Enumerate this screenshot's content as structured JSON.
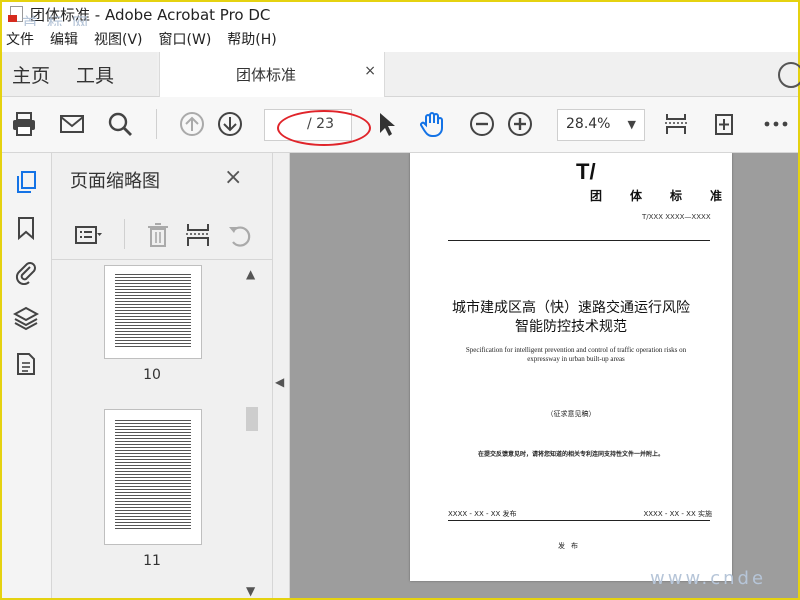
{
  "window": {
    "title": "团体标准 - Adobe Acrobat Pro DC",
    "watermark_top": "首 标 网",
    "watermark_bottom": "www.cnde"
  },
  "menu": [
    "文件",
    "编辑",
    "视图(V)",
    "窗口(W)",
    "帮助(H)"
  ],
  "tabs": {
    "home": "主页",
    "tools": "工具",
    "document": "团体标准",
    "close_glyph": "×"
  },
  "toolbar": {
    "page_current": "",
    "page_total": "/ 23",
    "zoom": "28.4%",
    "zoom_arrow": "▼"
  },
  "thumbnail_panel": {
    "title": "页面缩略图",
    "close_glyph": "×",
    "pages": [
      {
        "label": "10"
      },
      {
        "label": "11"
      }
    ]
  },
  "document": {
    "header_small": "",
    "t_mark": "T/",
    "standard_type": "团体标准",
    "standard_code": "T/XXX XXXX—XXXX",
    "title_line1": "城市建成区高（快）速路交通运行风险",
    "title_line2": "智能防控技术规范",
    "subtitle_en": "Specification for intelligent prevention and control of traffic operation risks on expressway in urban built-up areas",
    "draft_note": "（征求意见稿）",
    "submission_note": "在提交反馈意见时，请将您知道的相关专利连同支持性文件一并附上。",
    "publish_date": "XXXX - XX - XX 发布",
    "implement_date": "XXXX - XX - XX 实施",
    "issuer": "发布"
  },
  "colors": {
    "frame": "#e5d210",
    "annotation": "#e0242a",
    "accent_blue": "#1473e6",
    "doc_bg": "#9d9d9d"
  }
}
